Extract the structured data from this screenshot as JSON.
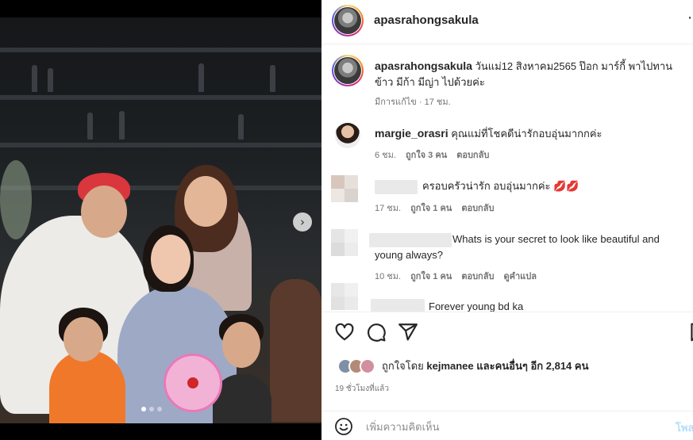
{
  "post": {
    "author": "apasrahongsakula",
    "caption": "วันแม่12 สิงหาคม2565 ป๊อก มาร์กี้ พาไปทานข้าว มีก้า มีญ่า ไปด้วยค่ะ",
    "caption_meta": "มีการแก้ไข · 17 ชม."
  },
  "comments": [
    {
      "user": "margie_orasri",
      "text": "คุณแม่ที่โชคดีน่ารักอบอุ่นมากกค่ะ",
      "time": "6 ชม.",
      "likes": "ถูกใจ 3 คน",
      "reply": "ตอบกลับ"
    },
    {
      "user": "",
      "text": "ครอบครัวน่ารัก อบอุ่นมากค่ะ",
      "emoji": "💋💋",
      "time": "17 ชม.",
      "likes": "ถูกใจ 1 คน",
      "reply": "ตอบกลับ"
    },
    {
      "user": "",
      "text": "Whats is your secret to look like beautiful and young always?",
      "time": "10 ชม.",
      "likes": "ถูกใจ 1 คน",
      "reply": "ตอบกลับ",
      "translate": "ดูคำแปล"
    },
    {
      "user": "",
      "text": "Forever young bd ka"
    }
  ],
  "likes": {
    "prefix": "ถูกใจโดย",
    "user": "kejmanee",
    "middle": "และ",
    "others": "คนอื่นๆ อีก 2,814 คน"
  },
  "post_time": "19 ชั่วโมงที่แล้ว",
  "composer": {
    "placeholder": "เพิ่มความคิดเห็น",
    "post_label": "โพสต์"
  },
  "icons": [
    "more-icon",
    "heart-icon",
    "comment-icon",
    "share-icon",
    "bookmark-icon",
    "smile-icon",
    "chevron-right-icon"
  ],
  "colors": {
    "link": "#0095f6",
    "post_disabled": "#b2dffc",
    "muted": "#737373",
    "lips": "#d1002b"
  }
}
